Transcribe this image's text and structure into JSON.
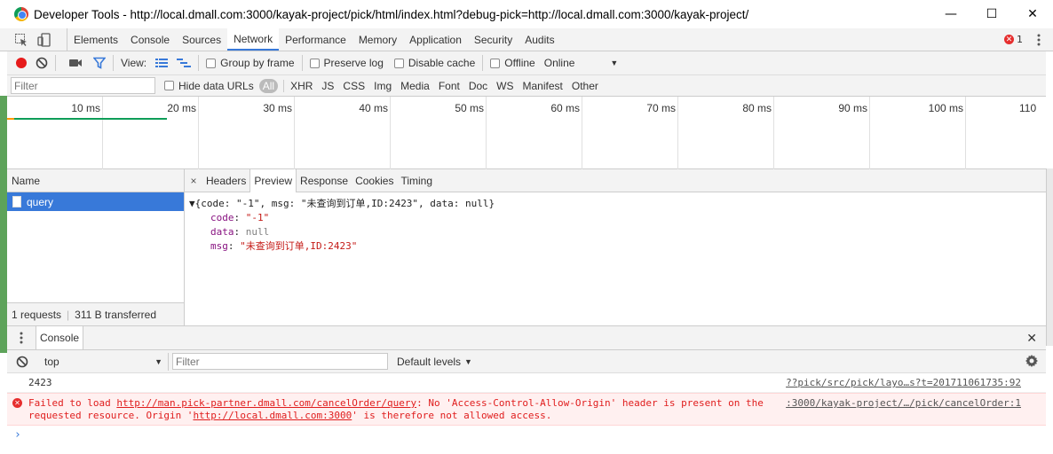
{
  "window": {
    "title": "Developer Tools - http://local.dmall.com:3000/kayak-project/pick/html/index.html?debug-pick=http://local.dmall.com:3000/kayak-project/",
    "minimize": "—",
    "maximize": "☐",
    "close": "✕"
  },
  "tabs": [
    "Elements",
    "Console",
    "Sources",
    "Network",
    "Performance",
    "Memory",
    "Application",
    "Security",
    "Audits"
  ],
  "active_tab": "Network",
  "error_count": "1",
  "network_toolbar": {
    "view_label": "View:",
    "group_by_frame": "Group by frame",
    "preserve_log": "Preserve log",
    "disable_cache": "Disable cache",
    "offline": "Offline",
    "throttle": "Online"
  },
  "filter": {
    "placeholder": "Filter",
    "hide_data_urls": "Hide data URLs",
    "types": [
      "All",
      "XHR",
      "JS",
      "CSS",
      "Img",
      "Media",
      "Font",
      "Doc",
      "WS",
      "Manifest",
      "Other"
    ]
  },
  "timeline": {
    "ticks": [
      "10 ms",
      "20 ms",
      "30 ms",
      "40 ms",
      "50 ms",
      "60 ms",
      "70 ms",
      "80 ms",
      "90 ms",
      "100 ms",
      "110"
    ]
  },
  "requests": {
    "header": "Name",
    "items": [
      "query"
    ],
    "summary_requests": "1 requests",
    "summary_transferred": "311 B transferred"
  },
  "detail": {
    "close": "×",
    "tabs": [
      "Headers",
      "Preview",
      "Response",
      "Cookies",
      "Timing"
    ],
    "active_tab": "Preview",
    "preview": {
      "summary": "{code: \"-1\", msg: \"未查询到订单,ID:2423\", data: null}",
      "props": [
        {
          "key": "code",
          "value": "\"-1\"",
          "kind": "string"
        },
        {
          "key": "data",
          "value": "null",
          "kind": "null"
        },
        {
          "key": "msg",
          "value": "\"未查询到订单,ID:2423\"",
          "kind": "string"
        }
      ]
    }
  },
  "drawer": {
    "tab": "Console",
    "context": "top",
    "filter_placeholder": "Filter",
    "levels": "Default levels",
    "messages": [
      {
        "type": "log",
        "text": "2423",
        "source": "??pick/src/pick/layo…s?t=201711061735:92"
      },
      {
        "type": "error",
        "pre": "Failed to load ",
        "url": "http://man.pick-partner.dmall.com/cancelOrder/query",
        "mid": ": No 'Access-Control-Allow-Origin' header is present on the requested resource. Origin '",
        "origin": "http://local.dmall.com:3000",
        "post": "' is therefore not allowed access.",
        "source": ":3000/kayak-project/…/pick/cancelOrder:1"
      }
    ],
    "prompt": "›"
  },
  "colors": {
    "accent": "#3879d9",
    "record": "#e61b1b",
    "error_text": "#e01d1d",
    "error_bg": "#fff0f0"
  }
}
